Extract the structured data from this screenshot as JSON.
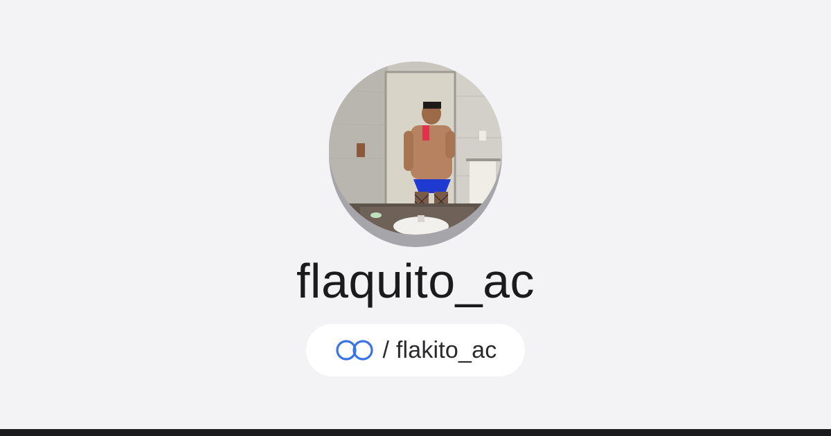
{
  "profile": {
    "username": "flaquito_ac",
    "avatar_icon": "profile-photo",
    "handle_prefix": "/ flakito_ac",
    "handle_icon": "linked-rings-icon"
  },
  "colors": {
    "background": "#f3f3f5",
    "pill_background": "#ffffff",
    "icon_blue": "#3a73e6",
    "text": "#1b1b1d",
    "bottom_bar": "#1b1b1d"
  }
}
